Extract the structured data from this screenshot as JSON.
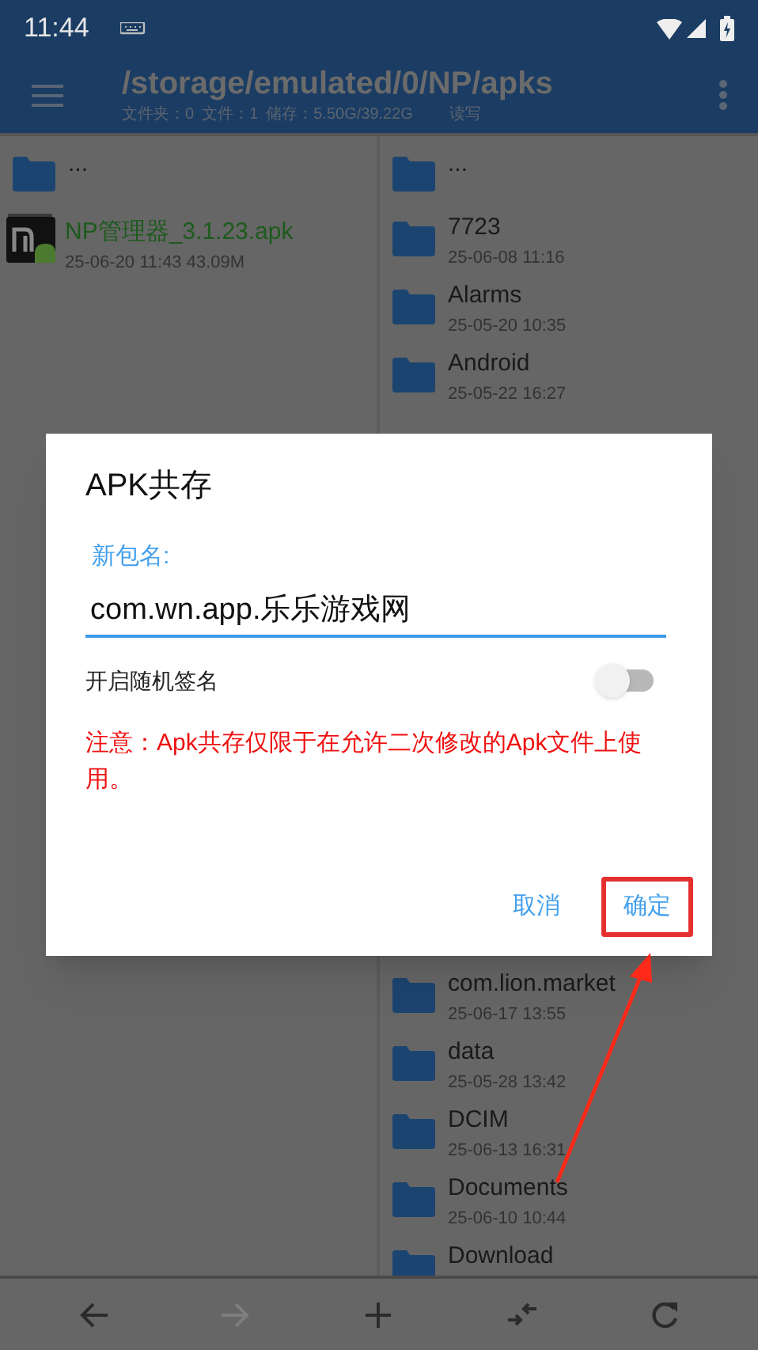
{
  "status_bar": {
    "time": "11:44"
  },
  "app_bar": {
    "path": "/storage/emulated/0/NP/apks",
    "info": [
      "文件夹：0",
      "文件：1",
      "储存：5.50G/39.22G",
      "读写"
    ]
  },
  "left_panel": {
    "items": [
      {
        "kind": "parent",
        "name": "..."
      },
      {
        "kind": "apk",
        "name": "NP管理器_3.1.23.apk",
        "meta": "25-06-20 11:43  43.09M"
      }
    ]
  },
  "right_panel": {
    "upper_items": [
      {
        "kind": "parent",
        "name": "..."
      },
      {
        "kind": "folder",
        "name": "7723",
        "meta": "25-06-08 11:16"
      },
      {
        "kind": "folder",
        "name": "Alarms",
        "meta": "25-05-20 10:35"
      },
      {
        "kind": "folder",
        "name": "Android",
        "meta": "25-05-22 16:27"
      }
    ],
    "lower_items": [
      {
        "kind": "folder",
        "name": "com.lion.market",
        "meta": "25-06-17 13:55"
      },
      {
        "kind": "folder",
        "name": "data",
        "meta": "25-05-28 13:42"
      },
      {
        "kind": "folder",
        "name": "DCIM",
        "meta": "25-06-13 16:31"
      },
      {
        "kind": "folder",
        "name": "Documents",
        "meta": "25-06-10 10:44"
      },
      {
        "kind": "folder",
        "name": "Download"
      }
    ]
  },
  "dialog": {
    "title": "APK共存",
    "field_label": "新包名:",
    "field_value": "com.wn.app.乐乐游戏网",
    "switch": {
      "label": "开启随机签名",
      "on": false
    },
    "warning": "注意：Apk共存仅限于在允许二次修改的Apk文件上使用。",
    "buttons": [
      {
        "label": "取消",
        "highlighted": false
      },
      {
        "label": "确定",
        "highlighted": true
      }
    ]
  },
  "bottom_bar": [
    {
      "kind": "back",
      "disabled": false
    },
    {
      "kind": "forward",
      "disabled": true
    },
    {
      "kind": "add",
      "disabled": false
    },
    {
      "kind": "swap",
      "disabled": false
    },
    {
      "kind": "refresh",
      "disabled": false
    }
  ]
}
